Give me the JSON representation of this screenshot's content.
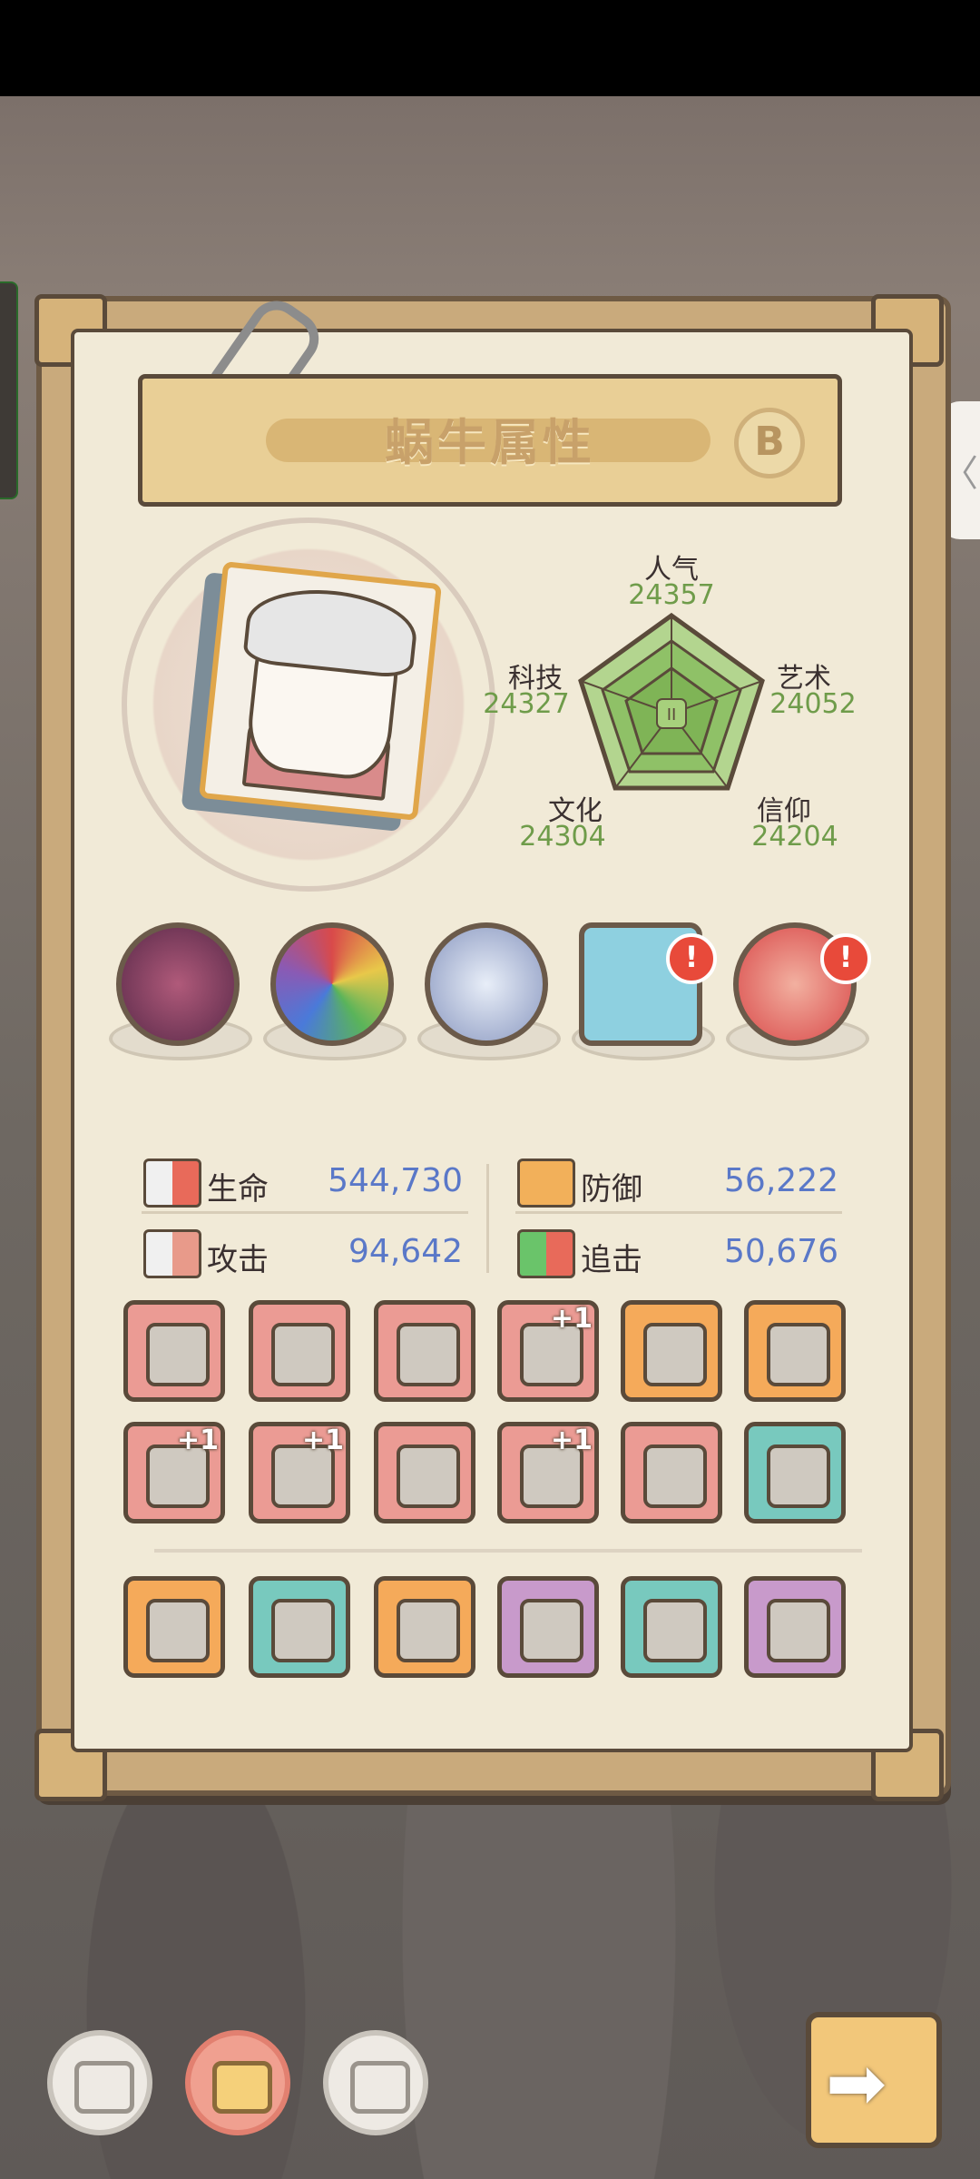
{
  "title": "蜗牛属性",
  "title_badge": "B",
  "radar": {
    "center_label": "II",
    "axes": [
      {
        "name": "人气",
        "value": "24357"
      },
      {
        "name": "艺术",
        "value": "24052"
      },
      {
        "name": "信仰",
        "value": "24204"
      },
      {
        "name": "文化",
        "value": "24304"
      },
      {
        "name": "科技",
        "value": "24327"
      }
    ]
  },
  "relics": [
    {
      "icon": "red-tentacle-orb-icon",
      "alert": false
    },
    {
      "icon": "rainbow-ball-icon",
      "alert": false
    },
    {
      "icon": "compass-icon",
      "alert": false
    },
    {
      "icon": "eye-tablet-icon",
      "alert": true,
      "alert_text": "!"
    },
    {
      "icon": "red-swirl-orb-icon",
      "alert": true,
      "alert_text": "!"
    }
  ],
  "stats": {
    "life": {
      "label": "生命",
      "value": "544,730"
    },
    "defense": {
      "label": "防御",
      "value": "56,222"
    },
    "attack": {
      "label": "攻击",
      "value": "94,642"
    },
    "chase": {
      "label": "追击",
      "value": "50,676"
    }
  },
  "equipment": [
    {
      "icon": "scythe-icon",
      "bg": "#eb9b94",
      "plus": ""
    },
    {
      "icon": "armor-icon",
      "bg": "#eb9b94",
      "plus": ""
    },
    {
      "icon": "chest-plate-icon",
      "bg": "#eb9b94",
      "plus": ""
    },
    {
      "icon": "gauntlet-icon",
      "bg": "#eb9b94",
      "plus": "+1"
    },
    {
      "icon": "helmet-icon",
      "bg": "#f5aa5a",
      "plus": ""
    },
    {
      "icon": "ring-icon",
      "bg": "#f5aa5a",
      "plus": ""
    },
    {
      "icon": "dagger-icon",
      "bg": "#eb9b94",
      "plus": "+1"
    },
    {
      "icon": "crossbow-icon",
      "bg": "#eb9b94",
      "plus": "+1"
    },
    {
      "icon": "serpent-staff-icon",
      "bg": "#eb9b94",
      "plus": ""
    },
    {
      "icon": "pants-icon",
      "bg": "#eb9b94",
      "plus": "+1"
    },
    {
      "icon": "sword-icon",
      "bg": "#eb9b94",
      "plus": ""
    },
    {
      "icon": "spiked-mace-icon",
      "bg": "#78c9be",
      "plus": ""
    },
    {
      "icon": "orange-armor-icon",
      "bg": "#f5aa5a",
      "plus": ""
    },
    {
      "icon": "blue-helmet-icon",
      "bg": "#78c9be",
      "plus": ""
    },
    {
      "icon": "hammer-icon",
      "bg": "#f5aa5a",
      "plus": ""
    },
    {
      "icon": "claw-glove-icon",
      "bg": "#c89acb",
      "plus": ""
    },
    {
      "icon": "whip-icon",
      "bg": "#78c9be",
      "plus": ""
    },
    {
      "icon": "katana-icon",
      "bg": "#c89acb",
      "plus": ""
    }
  ],
  "bottom_buttons": [
    {
      "icon": "skull-face-icon",
      "active": false
    },
    {
      "icon": "yellow-face-icon",
      "active": true
    },
    {
      "icon": "cracked-face-icon",
      "active": false
    }
  ],
  "next_button_icon": "arrow-right-icon",
  "side_tab_glyph": "〈"
}
